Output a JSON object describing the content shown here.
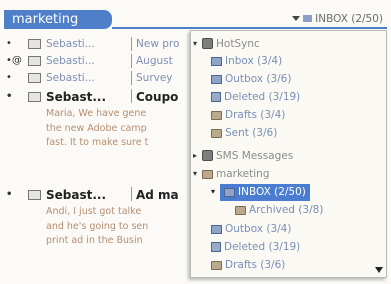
{
  "header": {
    "title": "marketing",
    "folder_selector": "INBOX (2/50)"
  },
  "messages": [
    {
      "sender": "Sebasti...",
      "subject": "New pro",
      "bold": false,
      "attachment": false
    },
    {
      "sender": "Sebasti...",
      "subject": "August",
      "bold": false,
      "attachment": true
    },
    {
      "sender": "Sebasti...",
      "subject": "Survey",
      "bold": false,
      "attachment": false
    },
    {
      "sender": "Sebast...",
      "subject": "Coupo",
      "bold": true,
      "attachment": false,
      "preview": [
        "Maria, We have gene",
        "the new Adobe camp",
        "fast. It to make sure t"
      ]
    },
    {
      "sender": "Sebast...",
      "subject": "Ad ma",
      "bold": true,
      "attachment": false,
      "preview": [
        "Andi, I just got talke",
        "and he's going to sen",
        "print ad in the Busin"
      ]
    }
  ],
  "folder_menu": {
    "hotsync": "HotSync",
    "hotsync_items": [
      "Inbox (3/4)",
      "Outbox (3/6)",
      "Deleted (3/19)",
      "Drafts (3/4)",
      "Sent (3/6)"
    ],
    "sms": "SMS Messages",
    "account": "marketing",
    "selected": "INBOX (2/50)",
    "archived": "Archived (3/8)",
    "account_items": [
      "Outbox (3/4)",
      "Deleted (3/19)",
      "Drafts (3/6)"
    ]
  },
  "colors": {
    "accent": "#4f7fc8",
    "selected_bg": "#4a7dd0",
    "folder_text": "#7a8fb5"
  }
}
